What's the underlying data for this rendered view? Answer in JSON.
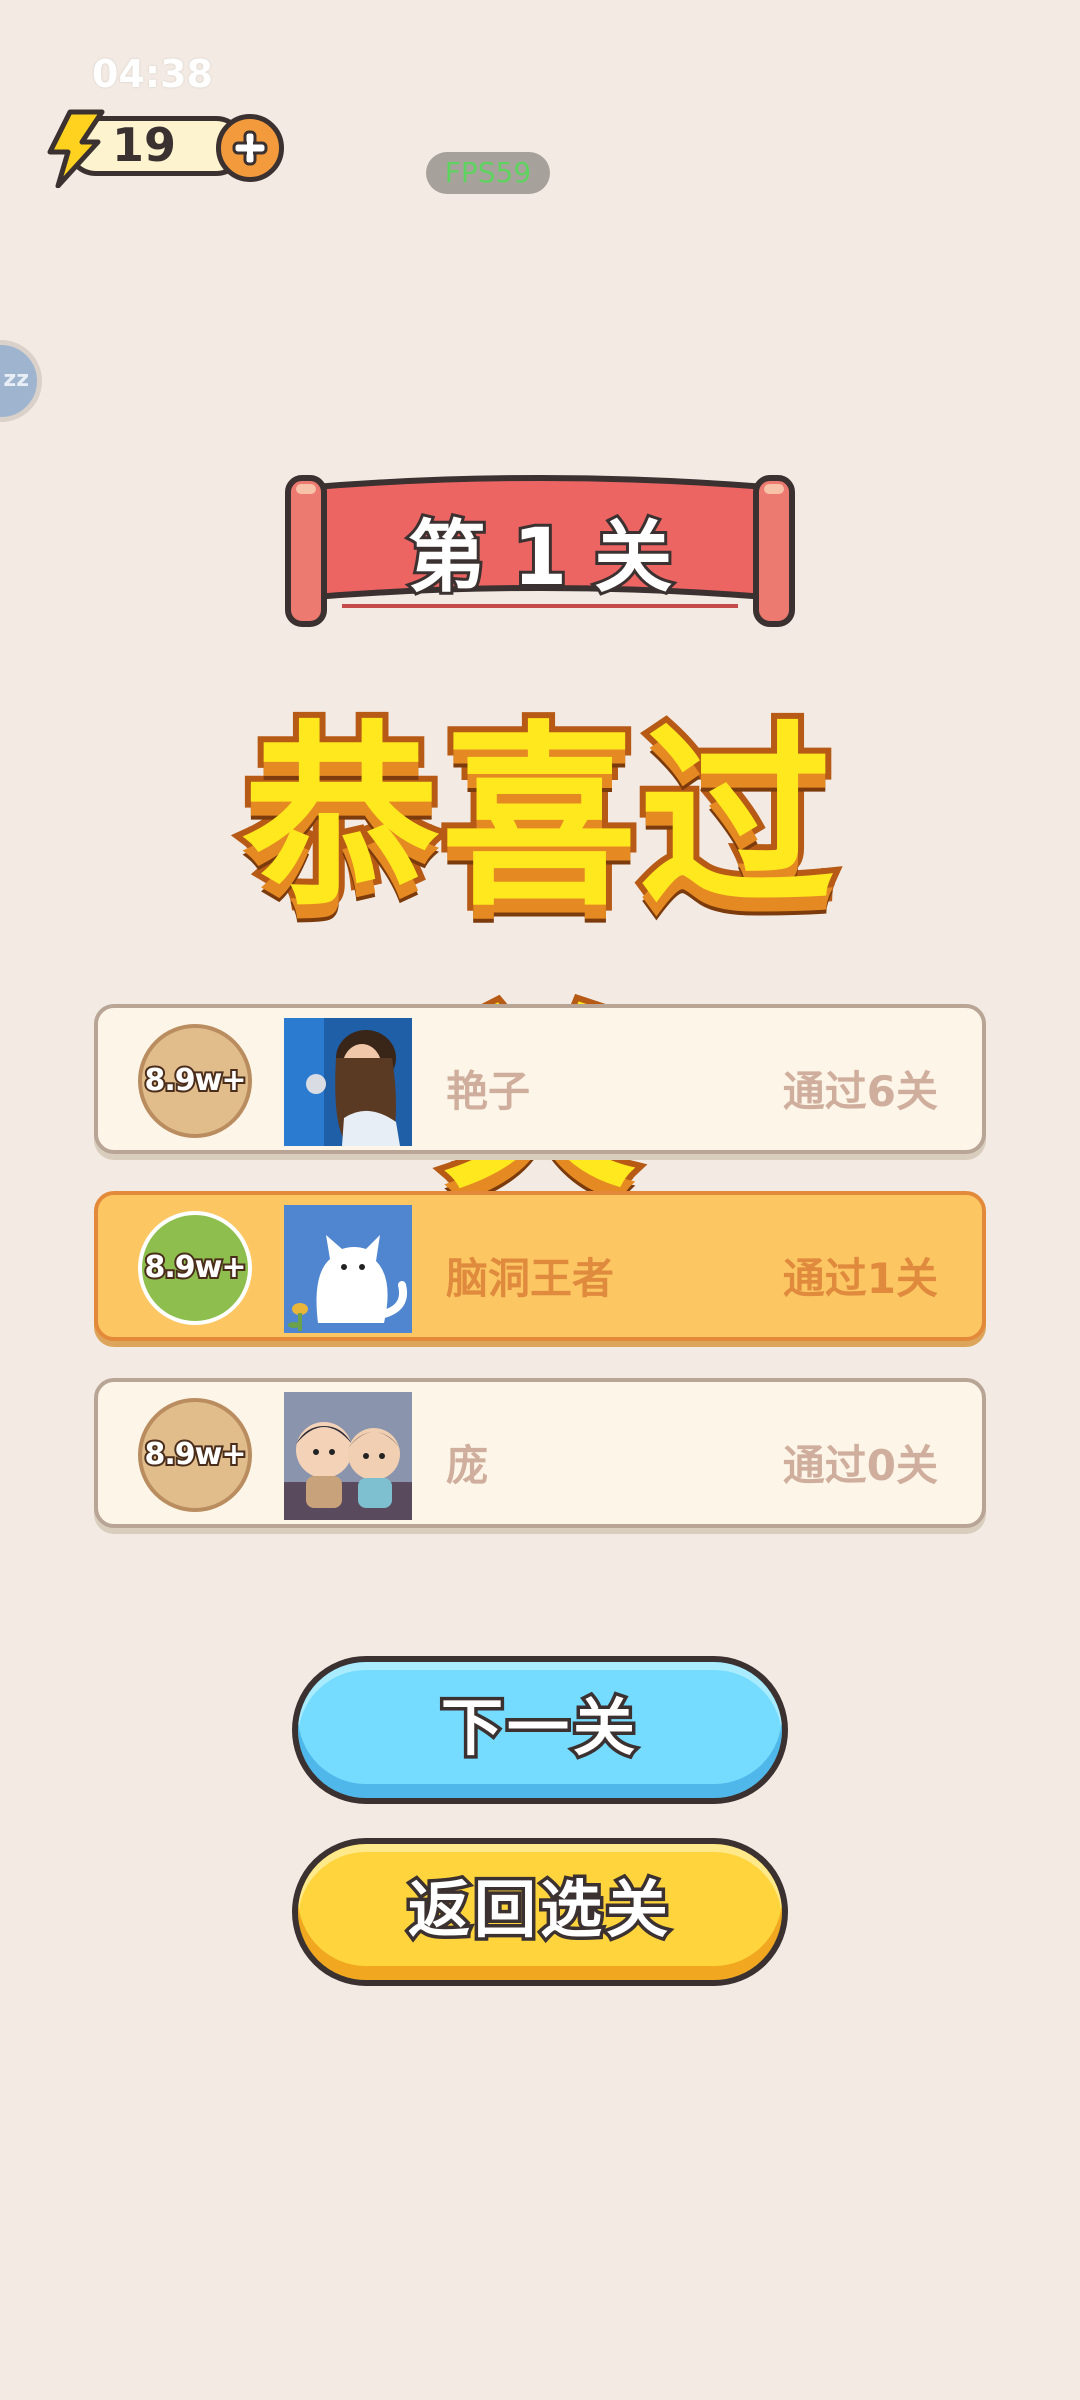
{
  "status": {
    "time": "04:38"
  },
  "energy": {
    "count": "19",
    "icon": "lightning-bolt-icon",
    "add_icon": "plus-icon"
  },
  "debug": {
    "fps": "FPS59"
  },
  "level": {
    "title": "第 1 关"
  },
  "result": {
    "title": "恭喜过关"
  },
  "ranking": [
    {
      "badge": "8.9w+",
      "name": "艳子",
      "progress": "通过6关",
      "is_me": false
    },
    {
      "badge": "8.9w+",
      "name": "脑洞王者",
      "progress": "通过1关",
      "is_me": true
    },
    {
      "badge": "8.9w+",
      "name": "庞",
      "progress": "通过0关",
      "is_me": false
    }
  ],
  "buttons": {
    "next": "下一关",
    "back": "返回选关"
  },
  "colors": {
    "background": "#f3ebe3",
    "accent_orange": "#e38a3a",
    "title_yellow": "#ffe81d",
    "next_blue": "#76dcff",
    "back_yellow": "#ffd43d"
  }
}
